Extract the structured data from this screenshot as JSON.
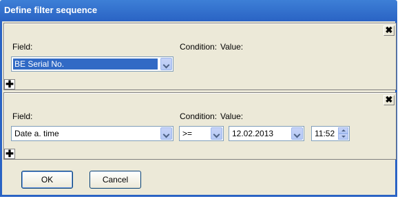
{
  "window": {
    "title": "Define filter sequence"
  },
  "filters": [
    {
      "field_label": "Field:",
      "condition_label": "Condition:",
      "value_label": "Value:",
      "field_value": "BE Serial No.",
      "close_icon": "close-x-icon",
      "add_icon": "plus-icon"
    },
    {
      "field_label": "Field:",
      "condition_label": "Condition:",
      "value_label": "Value:",
      "field_value": "Date a. time",
      "condition_value": ">=",
      "date_value": "12.02.2013",
      "time_value": "11:52",
      "close_icon": "close-x-icon",
      "add_icon": "plus-icon"
    }
  ],
  "buttons": {
    "ok": "OK",
    "cancel": "Cancel"
  },
  "colors": {
    "title_bar": "#2a63c4",
    "dialog_bg": "#ece9d8",
    "selection": "#316ac5"
  }
}
